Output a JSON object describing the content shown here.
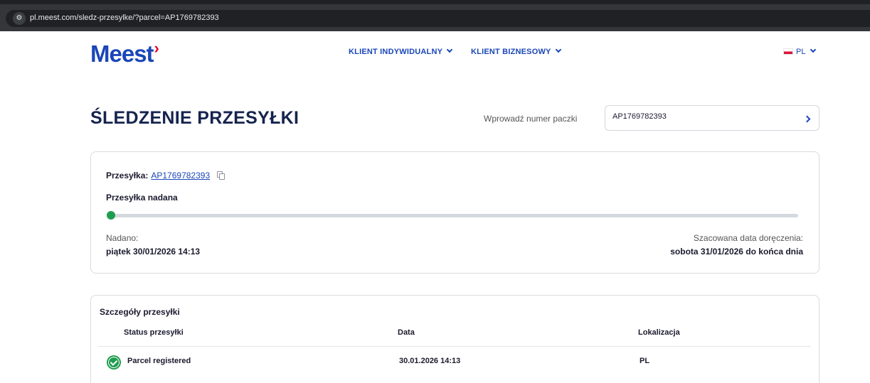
{
  "browser": {
    "url": "pl.meest.com/sledz-przesylke/?parcel=AP1769782393",
    "site_icon": "site-info-icon"
  },
  "header": {
    "logo_text": "Meest",
    "nav": [
      {
        "label": "KLIENT INDYWIDUALNY"
      },
      {
        "label": "KLIENT BIZNESOWY"
      }
    ],
    "language": "PL"
  },
  "tracking": {
    "title": "ŚLEDZENIE PRZESYŁKI",
    "search_label": "Wprowadź numer paczki",
    "search_value": "AP1769782393"
  },
  "shipment": {
    "label": "Przesyłka:",
    "number": "AP1769782393",
    "status": "Przesyłka nadana",
    "progress_fraction": 0,
    "sent_label": "Nadano:",
    "sent_value": "piątek 30/01/2026 14:13",
    "eta_label": "Szacowana data doręczenia:",
    "eta_value": "sobota 31/01/2026 do końca dnia"
  },
  "details": {
    "title": "Szczegóły przesyłki",
    "columns": [
      "Status przesyłki",
      "Data",
      "Lokalizacja"
    ],
    "rows": [
      {
        "status": "Parcel registered",
        "date": "30.01.2026 14:13",
        "location": "PL"
      }
    ]
  },
  "colors": {
    "brand_blue": "#1a46b8",
    "brand_red": "#e4002b",
    "success_green": "#1f9d4f"
  }
}
